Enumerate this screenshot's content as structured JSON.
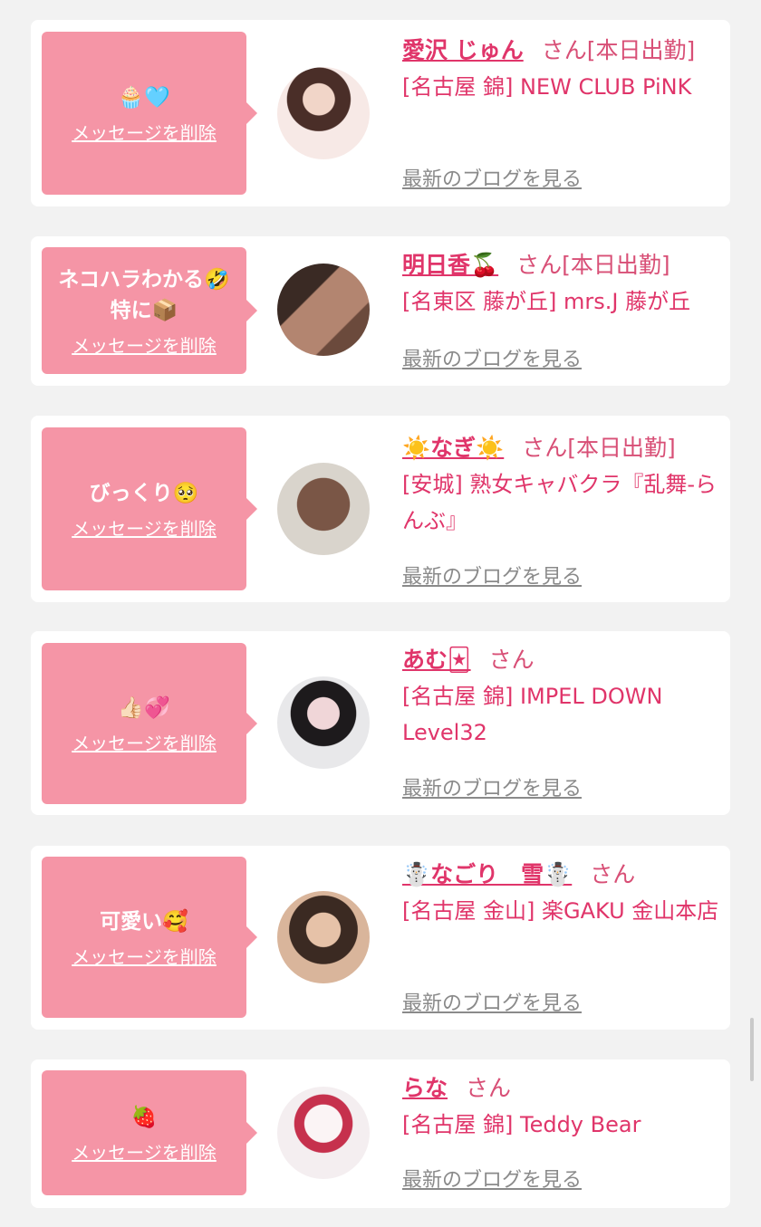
{
  "items": [
    {
      "message": "🧁🩵",
      "delete_label": "メッセージを削除",
      "name": "愛沢 じゅん",
      "honorific": "さん",
      "status": "[本日出勤]",
      "shop": "[名古屋 錦] NEW CLUB PiNK",
      "blog_label": "最新のブログを見る",
      "avatar_colors": [
        "#f7e9e6",
        "#4a2e28"
      ]
    },
    {
      "message": "ネコハラわかる🤣\n特に📦",
      "delete_label": "メッセージを削除",
      "name": "明日香🍒",
      "honorific": "さん",
      "status": "[本日出勤]",
      "shop": "[名東区 藤が丘] mrs.J 藤が丘",
      "blog_label": "最新のブログを見る",
      "avatar_colors": [
        "#3a2a24",
        "#b38570"
      ]
    },
    {
      "message": "びっくり🥺",
      "delete_label": "メッセージを削除",
      "name": "☀️なぎ☀️",
      "honorific": "さん",
      "status": "[本日出勤]",
      "shop": "[安城] 熟女キャバクラ『乱舞-らんぶ』",
      "blog_label": "最新のブログを見る",
      "avatar_colors": [
        "#d9d4cc",
        "#7a5646"
      ]
    },
    {
      "message": "👍🏻💞",
      "delete_label": "メッセージを削除",
      "name": "あむ🃏",
      "honorific": "さん",
      "status": "",
      "shop": "[名古屋 錦] IMPEL DOWN Level32",
      "blog_label": "最新のブログを見る",
      "avatar_colors": [
        "#e8e8ea",
        "#1d1a1c"
      ]
    },
    {
      "message": "可愛い🥰",
      "delete_label": "メッセージを削除",
      "name": "☃️なごり　雪☃️",
      "honorific": "さん",
      "status": "",
      "shop": "[名古屋 金山] 楽GAKU 金山本店",
      "blog_label": "最新のブログを見る",
      "avatar_colors": [
        "#3b2a22",
        "#d9b59b"
      ]
    },
    {
      "message": "🍓",
      "delete_label": "メッセージを削除",
      "name": "らな",
      "honorific": "さん",
      "status": "",
      "shop": "[名古屋 錦] Teddy Bear",
      "blog_label": "最新のブログを見る",
      "avatar_colors": [
        "#f4eef0",
        "#c6314d"
      ]
    }
  ]
}
